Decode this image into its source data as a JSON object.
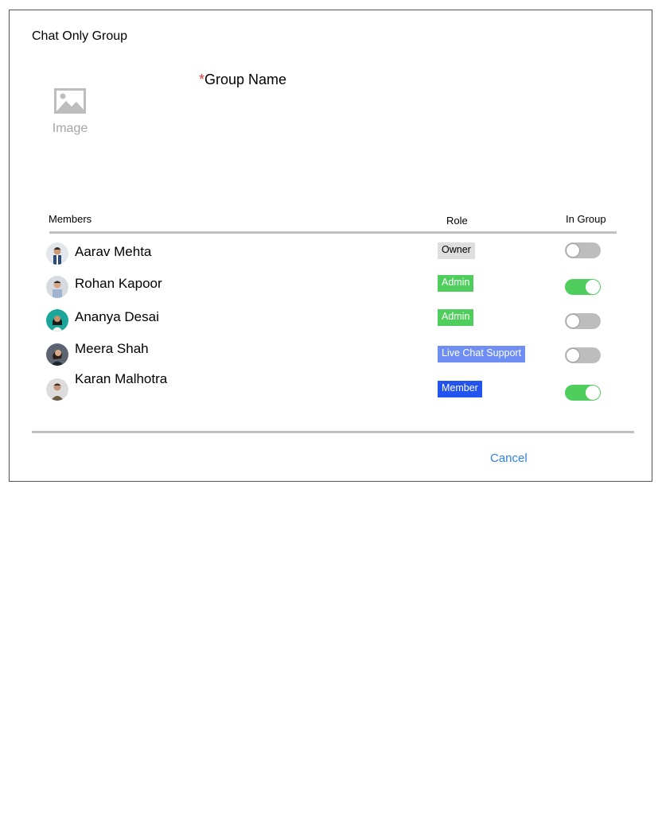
{
  "dialog": {
    "title": "Chat Only Group",
    "image_label": "Image",
    "group_name_required_marker": "*",
    "group_name_label": "Group Name",
    "image_icon": "image-placeholder-icon"
  },
  "table": {
    "headers": {
      "members": "Members",
      "role": "Role",
      "in_group": "In Group"
    },
    "rows": [
      {
        "name": "Aarav Mehta",
        "role": "Owner",
        "role_bg": "#dedede",
        "role_fg": "#000000",
        "in_group": false
      },
      {
        "name": "Rohan Kapoor",
        "role": "Admin",
        "role_bg": "#4fce5d",
        "role_fg": "#ffffff",
        "in_group": true
      },
      {
        "name": "Ananya Desai",
        "role": "Admin",
        "role_bg": "#4fce5d",
        "role_fg": "#ffffff",
        "in_group": false
      },
      {
        "name": "Meera Shah",
        "role": "Live Chat Support",
        "role_bg": "#6f8ef4",
        "role_fg": "#ffffff",
        "in_group": false
      },
      {
        "name": "Karan Malhotra",
        "role": "Member",
        "role_bg": "#2354f0",
        "role_fg": "#ffffff",
        "in_group": true
      }
    ]
  },
  "footer": {
    "cancel_label": "Cancel"
  },
  "colors": {
    "toggle_on": "#4fce5d",
    "toggle_off": "#bdbdbd",
    "link": "#2f80ed",
    "required": "#e53935"
  }
}
